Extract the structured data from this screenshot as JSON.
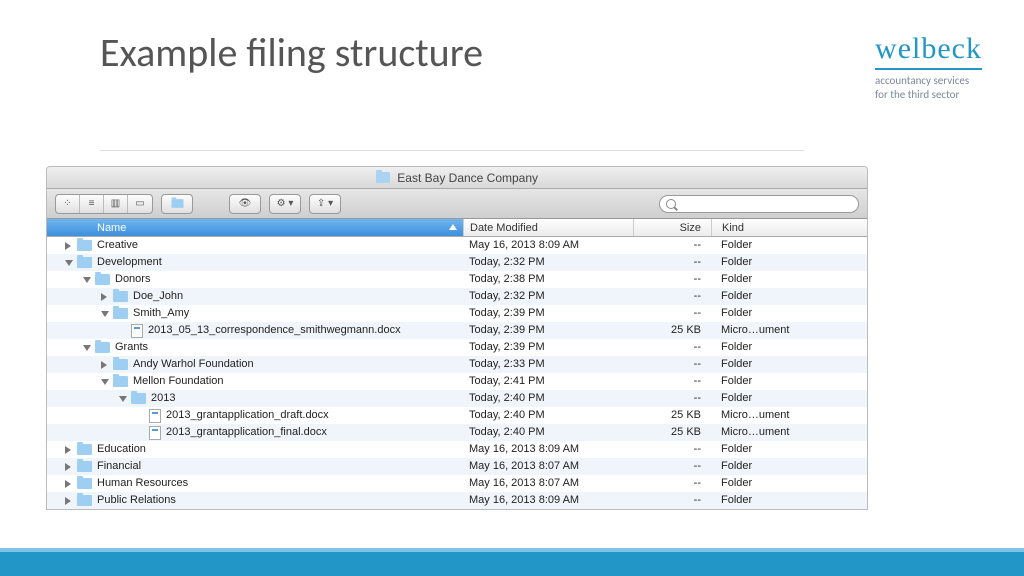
{
  "slide": {
    "title": "Example filing structure"
  },
  "brand": {
    "name": "welbeck",
    "tagline1": "accountancy services",
    "tagline2": "for the third sector"
  },
  "finder": {
    "window_title": "East Bay Dance Company",
    "search_placeholder": "",
    "columns": {
      "name": "Name",
      "date": "Date Modified",
      "size": "Size",
      "kind": "Kind"
    },
    "rows": [
      {
        "indent": 0,
        "disc": "closed",
        "icon": "folder",
        "name": "Creative",
        "date": "May 16, 2013 8:09 AM",
        "size": "--",
        "kind": "Folder"
      },
      {
        "indent": 0,
        "disc": "open",
        "icon": "folder",
        "name": "Development",
        "date": "Today, 2:32 PM",
        "size": "--",
        "kind": "Folder"
      },
      {
        "indent": 1,
        "disc": "open",
        "icon": "folder",
        "name": "Donors",
        "date": "Today, 2:38 PM",
        "size": "--",
        "kind": "Folder"
      },
      {
        "indent": 2,
        "disc": "closed",
        "icon": "folder",
        "name": "Doe_John",
        "date": "Today, 2:32 PM",
        "size": "--",
        "kind": "Folder"
      },
      {
        "indent": 2,
        "disc": "open",
        "icon": "folder",
        "name": "Smith_Amy",
        "date": "Today, 2:39 PM",
        "size": "--",
        "kind": "Folder"
      },
      {
        "indent": 3,
        "disc": "none",
        "icon": "doc",
        "name": "2013_05_13_correspondence_smithwegmann.docx",
        "date": "Today, 2:39 PM",
        "size": "25 KB",
        "kind": "Micro…ument"
      },
      {
        "indent": 1,
        "disc": "open",
        "icon": "folder",
        "name": "Grants",
        "date": "Today, 2:39 PM",
        "size": "--",
        "kind": "Folder"
      },
      {
        "indent": 2,
        "disc": "closed",
        "icon": "folder",
        "name": "Andy Warhol Foundation",
        "date": "Today, 2:33 PM",
        "size": "--",
        "kind": "Folder"
      },
      {
        "indent": 2,
        "disc": "open",
        "icon": "folder",
        "name": "Mellon Foundation",
        "date": "Today, 2:41 PM",
        "size": "--",
        "kind": "Folder"
      },
      {
        "indent": 3,
        "disc": "open",
        "icon": "folder",
        "name": "2013",
        "date": "Today, 2:40 PM",
        "size": "--",
        "kind": "Folder"
      },
      {
        "indent": 4,
        "disc": "none",
        "icon": "doc",
        "name": "2013_grantapplication_draft.docx",
        "date": "Today, 2:40 PM",
        "size": "25 KB",
        "kind": "Micro…ument"
      },
      {
        "indent": 4,
        "disc": "none",
        "icon": "doc",
        "name": "2013_grantapplication_final.docx",
        "date": "Today, 2:40 PM",
        "size": "25 KB",
        "kind": "Micro…ument"
      },
      {
        "indent": 0,
        "disc": "closed",
        "icon": "folder",
        "name": "Education",
        "date": "May 16, 2013 8:09 AM",
        "size": "--",
        "kind": "Folder"
      },
      {
        "indent": 0,
        "disc": "closed",
        "icon": "folder",
        "name": "Financial",
        "date": "May 16, 2013 8:07 AM",
        "size": "--",
        "kind": "Folder"
      },
      {
        "indent": 0,
        "disc": "closed",
        "icon": "folder",
        "name": "Human Resources",
        "date": "May 16, 2013 8:07 AM",
        "size": "--",
        "kind": "Folder"
      },
      {
        "indent": 0,
        "disc": "closed",
        "icon": "folder",
        "name": "Public Relations",
        "date": "May 16, 2013 8:09 AM",
        "size": "--",
        "kind": "Folder"
      }
    ]
  }
}
